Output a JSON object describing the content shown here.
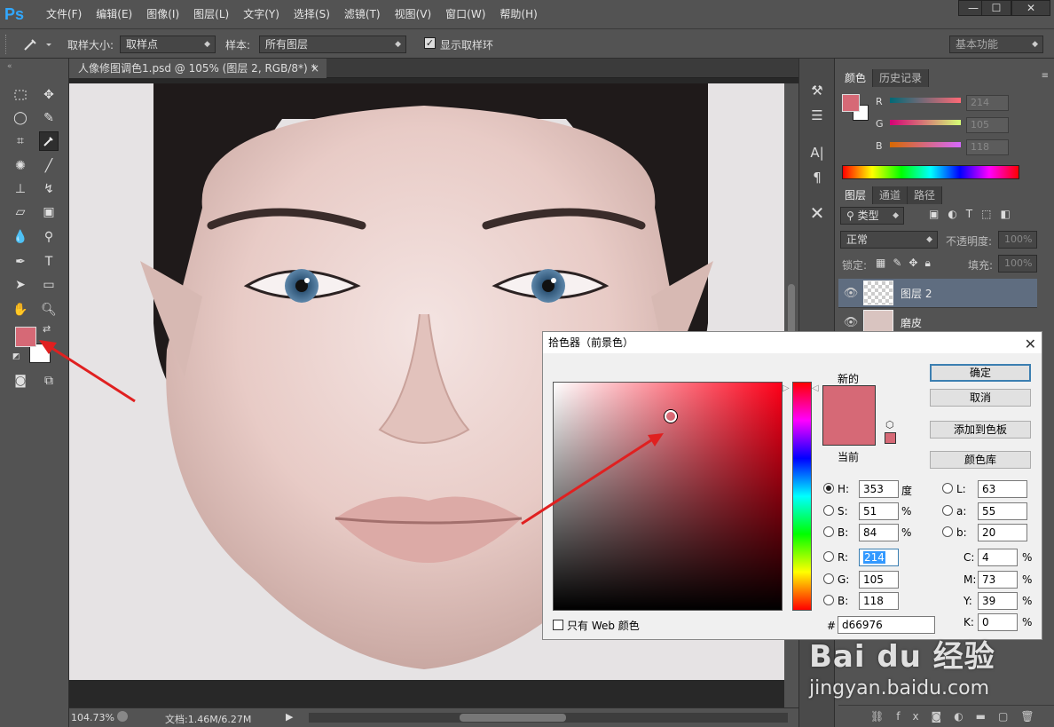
{
  "app": {
    "logo": "Ps"
  },
  "menu": [
    "文件(F)",
    "编辑(E)",
    "图像(I)",
    "图层(L)",
    "文字(Y)",
    "选择(S)",
    "滤镜(T)",
    "视图(V)",
    "窗口(W)",
    "帮助(H)"
  ],
  "window_controls": {
    "minimize": "—",
    "maximize": "☐",
    "close": "✕"
  },
  "options": {
    "sample_size_label": "取样大小:",
    "sample_size_value": "取样点",
    "sample_label": "样本:",
    "sample_value": "所有图层",
    "show_ring_label": "显示取样环",
    "show_ring_checked": true,
    "workspace": "基本功能"
  },
  "document": {
    "tab_title": "人像修图调色1.psd @ 105% (图层 2, RGB/8*) *",
    "tab_close": "×"
  },
  "status": {
    "zoom": "104.73%",
    "doc_info": "文档:1.46M/6.27M"
  },
  "colors": {
    "foreground": "#d66976",
    "background": "#ffffff",
    "picker_hue": "#ff0019",
    "annotation_arrow": "#e02020"
  },
  "color_panel": {
    "tabs": [
      "颜色",
      "历史记录"
    ],
    "channels": [
      {
        "label": "R",
        "value": "214"
      },
      {
        "label": "G",
        "value": "105"
      },
      {
        "label": "B",
        "value": "118"
      }
    ]
  },
  "layers_panel": {
    "tabs": [
      "图层",
      "通道",
      "路径"
    ],
    "filter_label": "类型",
    "blend_mode": "正常",
    "opacity_label": "不透明度:",
    "opacity_value": "100%",
    "lock_label": "锁定:",
    "fill_label": "填充:",
    "fill_value": "100%",
    "layers": [
      {
        "name": "图层 2",
        "selected": true
      },
      {
        "name": "磨皮",
        "selected": false
      }
    ]
  },
  "color_picker": {
    "title": "拾色器（前景色）",
    "new_label": "新的",
    "current_label": "当前",
    "buttons": {
      "ok": "确定",
      "cancel": "取消",
      "add_swatch": "添加到色板",
      "libraries": "颜色库"
    },
    "hsb": [
      {
        "label": "H:",
        "value": "353",
        "unit": "度",
        "selected": true
      },
      {
        "label": "S:",
        "value": "51",
        "unit": "%"
      },
      {
        "label": "B:",
        "value": "84",
        "unit": "%"
      }
    ],
    "rgb": [
      {
        "label": "R:",
        "value": "214"
      },
      {
        "label": "G:",
        "value": "105"
      },
      {
        "label": "B:",
        "value": "118"
      }
    ],
    "lab": [
      {
        "label": "L:",
        "value": "63"
      },
      {
        "label": "a:",
        "value": "55"
      },
      {
        "label": "b:",
        "value": "20"
      }
    ],
    "cmyk": [
      {
        "label": "C:",
        "value": "4",
        "unit": "%"
      },
      {
        "label": "M:",
        "value": "73",
        "unit": "%"
      },
      {
        "label": "Y:",
        "value": "39",
        "unit": "%"
      },
      {
        "label": "K:",
        "value": "0",
        "unit": "%"
      }
    ],
    "hex_label": "#",
    "hex_value": "d66976",
    "web_only_label": "只有 Web 颜色"
  },
  "watermark": {
    "brand": "Bai du 经验",
    "url": "jingyan.baidu.com"
  }
}
